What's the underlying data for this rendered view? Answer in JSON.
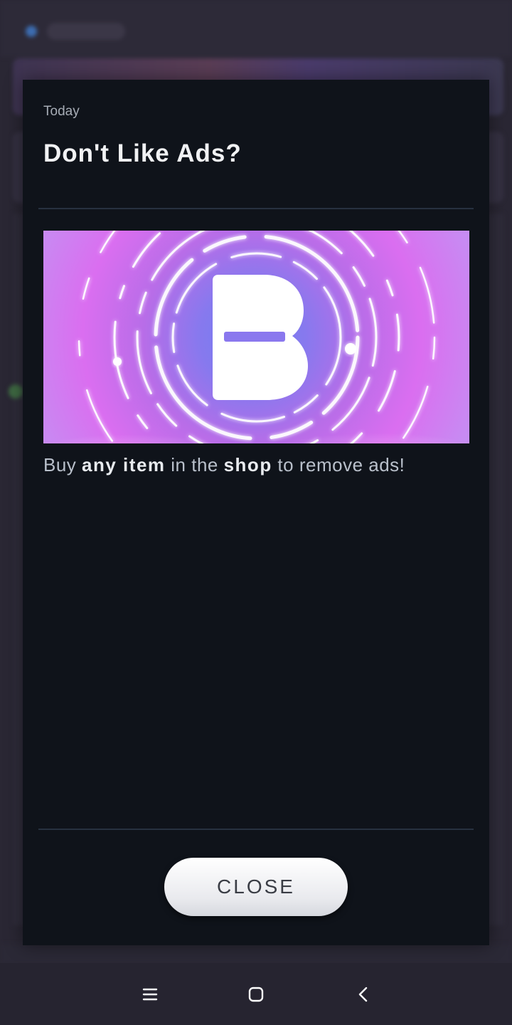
{
  "dialog": {
    "date": "Today",
    "title": "Don't Like Ads?",
    "body": {
      "part1": "Buy ",
      "em1": "any item",
      "part2": " in the ",
      "em2": "shop",
      "part3": " to remove ads!"
    },
    "close_label": "CLOSE"
  },
  "promo_image": {
    "icon": "b-logo-icon",
    "style": "neon rings on purple-pink gradient"
  },
  "navbar": {
    "icons": [
      "menu-icon",
      "home-icon",
      "back-icon"
    ]
  },
  "colors": {
    "dialog_bg": "#0f131a",
    "button_bg": "#eceef2",
    "accent_gradient_start": "#da6ef0",
    "accent_gradient_end": "#6f7ef2"
  }
}
